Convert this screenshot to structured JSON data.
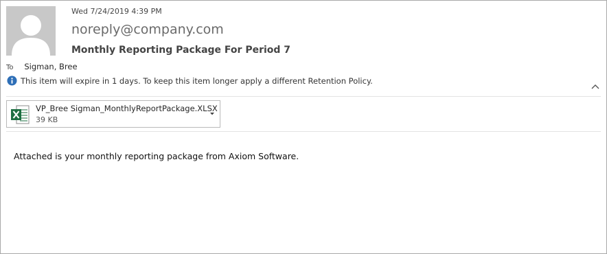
{
  "header": {
    "datetime": "Wed 7/24/2019 4:39 PM",
    "sender": "noreply@company.com",
    "subject": "Monthly Reporting Package For Period 7"
  },
  "recipients": {
    "to_label": "To",
    "to_name": "Sigman, Bree"
  },
  "info_bar": {
    "icon": "info-icon",
    "text": "This item will expire in 1 days. To keep this item longer apply a different Retention Policy."
  },
  "attachment": {
    "icon": "excel-file-icon",
    "name": "VP_Bree Sigman_MonthlyReportPackage.XLSX",
    "size": "39 KB"
  },
  "body": {
    "text": "Attached is your monthly reporting package from Axiom Software."
  },
  "colors": {
    "avatar_bg": "#c8c8c8",
    "info_blue": "#2e6fb7",
    "excel_green": "#1d6f42"
  }
}
